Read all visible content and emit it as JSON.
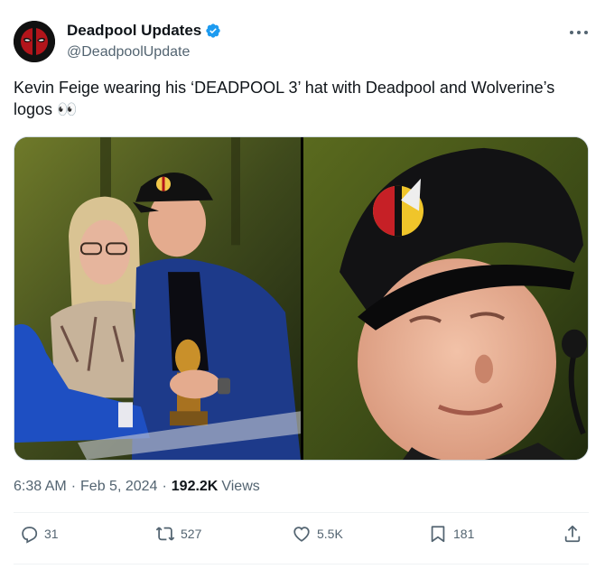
{
  "author": {
    "display_name": "Deadpool Updates",
    "handle": "@DeadpoolUpdate",
    "verified_icon": "verified-badge-icon",
    "avatar_icon": "deadpool-mask-icon"
  },
  "tweet": {
    "text": "Kevin Feige wearing his ‘DEADPOOL 3’ hat with Deadpool and Wolverine’s logos 👀"
  },
  "media": {
    "images": [
      {
        "name": "photo-kevin-feige-award"
      },
      {
        "name": "photo-kevin-feige-closeup"
      }
    ]
  },
  "meta": {
    "time": "6:38 AM",
    "separator": "·",
    "date": "Feb 5, 2024",
    "views_count": "192.2K",
    "views_label": "Views"
  },
  "actions": {
    "replies": "31",
    "reposts": "527",
    "likes": "5.5K",
    "bookmarks": "181"
  },
  "colors": {
    "text": "#0f1419",
    "secondary": "#536471",
    "verified": "#1d9bf0",
    "divider": "#eff3f4"
  }
}
